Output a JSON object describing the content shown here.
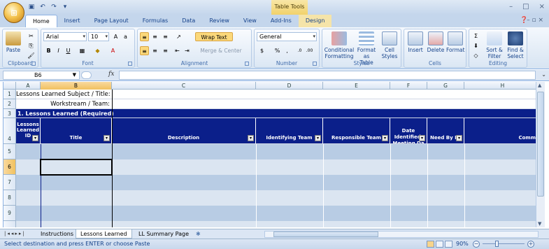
{
  "app": {
    "office_button_glyph": "⊞",
    "contextual_tab_group": "Table Tools",
    "window_controls": [
      "–",
      "□",
      "×"
    ]
  },
  "ribbon_tabs": [
    {
      "label": "Home",
      "active": true
    },
    {
      "label": "Insert"
    },
    {
      "label": "Page Layout"
    },
    {
      "label": "Formulas"
    },
    {
      "label": "Data"
    },
    {
      "label": "Review"
    },
    {
      "label": "View"
    },
    {
      "label": "Add-Ins"
    },
    {
      "label": "Design",
      "contextual": true
    }
  ],
  "ribbon": {
    "clipboard": {
      "label": "Clipboard",
      "paste": "Paste"
    },
    "font": {
      "label": "Font",
      "font_name": "Arial",
      "font_size": "10"
    },
    "alignment": {
      "label": "Alignment",
      "wrap_text": "Wrap Text",
      "merge_center": "Merge & Center"
    },
    "number": {
      "label": "Number",
      "format": "General",
      "currency": "$",
      "percent": "%",
      "comma": ","
    },
    "styles": {
      "label": "Styles",
      "conditional_formatting": "Conditional Formatting",
      "format_as_table": "Format as Table",
      "cell_styles": "Cell Styles"
    },
    "cells": {
      "label": "Cells",
      "insert": "Insert",
      "delete": "Delete",
      "format": "Format"
    },
    "editing": {
      "label": "Editing",
      "sort_filter": "Sort & Filter",
      "find_select": "Find & Select"
    }
  },
  "formula_bar": {
    "name_box": "B6",
    "fx": "fx",
    "value": ""
  },
  "columns": [
    "A",
    "B",
    "C",
    "D",
    "E",
    "F",
    "G",
    "H"
  ],
  "rows": {
    "r1": {
      "num": "1",
      "label": "Lessons Learned Subject / Title:"
    },
    "r2": {
      "num": "2",
      "label": "Workstream / Team:"
    },
    "r3": {
      "num": "3",
      "label": "1. Lessons Learned (Required)"
    },
    "r4": {
      "num": "4",
      "headers": [
        "Lessons Learned ID",
        "Title",
        "Description",
        "Identifying Team",
        "Responsible Team",
        "Date Identified/ Meeting Da",
        "Need By Da",
        "Comm"
      ]
    },
    "data_rows": [
      "5",
      "6",
      "7",
      "8",
      "9"
    ]
  },
  "sheet_tabs": [
    {
      "label": "Instructions"
    },
    {
      "label": "Lessons Learned",
      "active": true
    },
    {
      "label": "LL Summary Page"
    }
  ],
  "status": {
    "message": "Select destination and press ENTER or choose Paste",
    "zoom": "90%"
  },
  "colors": {
    "header_fill": "#0b1f8a",
    "band_dark": "#b8cce4",
    "band_light": "#dbe5f1"
  }
}
